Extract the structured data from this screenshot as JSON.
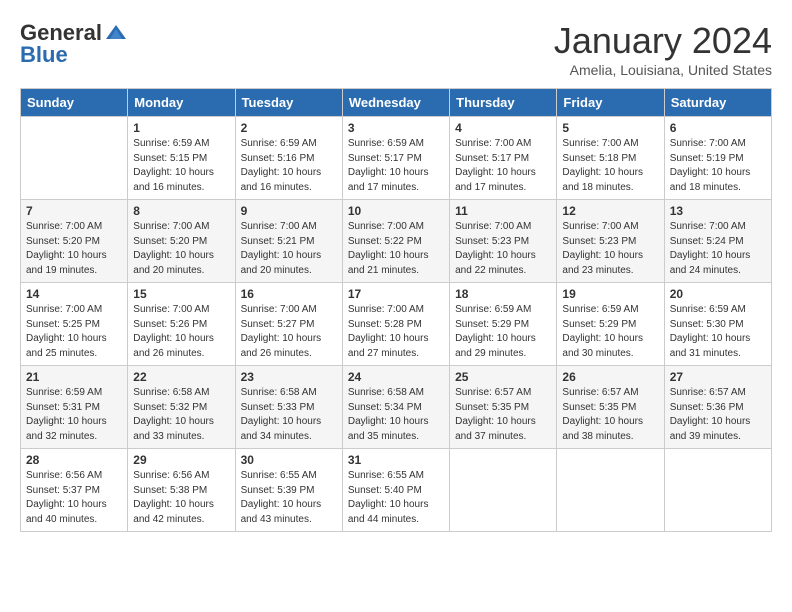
{
  "header": {
    "logo_general": "General",
    "logo_blue": "Blue",
    "month_title": "January 2024",
    "location": "Amelia, Louisiana, United States"
  },
  "days_of_week": [
    "Sunday",
    "Monday",
    "Tuesday",
    "Wednesday",
    "Thursday",
    "Friday",
    "Saturday"
  ],
  "weeks": [
    [
      {
        "day": "",
        "sunrise": "",
        "sunset": "",
        "daylight": ""
      },
      {
        "day": "1",
        "sunrise": "Sunrise: 6:59 AM",
        "sunset": "Sunset: 5:15 PM",
        "daylight": "Daylight: 10 hours and 16 minutes."
      },
      {
        "day": "2",
        "sunrise": "Sunrise: 6:59 AM",
        "sunset": "Sunset: 5:16 PM",
        "daylight": "Daylight: 10 hours and 16 minutes."
      },
      {
        "day": "3",
        "sunrise": "Sunrise: 6:59 AM",
        "sunset": "Sunset: 5:17 PM",
        "daylight": "Daylight: 10 hours and 17 minutes."
      },
      {
        "day": "4",
        "sunrise": "Sunrise: 7:00 AM",
        "sunset": "Sunset: 5:17 PM",
        "daylight": "Daylight: 10 hours and 17 minutes."
      },
      {
        "day": "5",
        "sunrise": "Sunrise: 7:00 AM",
        "sunset": "Sunset: 5:18 PM",
        "daylight": "Daylight: 10 hours and 18 minutes."
      },
      {
        "day": "6",
        "sunrise": "Sunrise: 7:00 AM",
        "sunset": "Sunset: 5:19 PM",
        "daylight": "Daylight: 10 hours and 18 minutes."
      }
    ],
    [
      {
        "day": "7",
        "sunrise": "Sunrise: 7:00 AM",
        "sunset": "Sunset: 5:20 PM",
        "daylight": "Daylight: 10 hours and 19 minutes."
      },
      {
        "day": "8",
        "sunrise": "Sunrise: 7:00 AM",
        "sunset": "Sunset: 5:20 PM",
        "daylight": "Daylight: 10 hours and 20 minutes."
      },
      {
        "day": "9",
        "sunrise": "Sunrise: 7:00 AM",
        "sunset": "Sunset: 5:21 PM",
        "daylight": "Daylight: 10 hours and 20 minutes."
      },
      {
        "day": "10",
        "sunrise": "Sunrise: 7:00 AM",
        "sunset": "Sunset: 5:22 PM",
        "daylight": "Daylight: 10 hours and 21 minutes."
      },
      {
        "day": "11",
        "sunrise": "Sunrise: 7:00 AM",
        "sunset": "Sunset: 5:23 PM",
        "daylight": "Daylight: 10 hours and 22 minutes."
      },
      {
        "day": "12",
        "sunrise": "Sunrise: 7:00 AM",
        "sunset": "Sunset: 5:23 PM",
        "daylight": "Daylight: 10 hours and 23 minutes."
      },
      {
        "day": "13",
        "sunrise": "Sunrise: 7:00 AM",
        "sunset": "Sunset: 5:24 PM",
        "daylight": "Daylight: 10 hours and 24 minutes."
      }
    ],
    [
      {
        "day": "14",
        "sunrise": "Sunrise: 7:00 AM",
        "sunset": "Sunset: 5:25 PM",
        "daylight": "Daylight: 10 hours and 25 minutes."
      },
      {
        "day": "15",
        "sunrise": "Sunrise: 7:00 AM",
        "sunset": "Sunset: 5:26 PM",
        "daylight": "Daylight: 10 hours and 26 minutes."
      },
      {
        "day": "16",
        "sunrise": "Sunrise: 7:00 AM",
        "sunset": "Sunset: 5:27 PM",
        "daylight": "Daylight: 10 hours and 26 minutes."
      },
      {
        "day": "17",
        "sunrise": "Sunrise: 7:00 AM",
        "sunset": "Sunset: 5:28 PM",
        "daylight": "Daylight: 10 hours and 27 minutes."
      },
      {
        "day": "18",
        "sunrise": "Sunrise: 6:59 AM",
        "sunset": "Sunset: 5:29 PM",
        "daylight": "Daylight: 10 hours and 29 minutes."
      },
      {
        "day": "19",
        "sunrise": "Sunrise: 6:59 AM",
        "sunset": "Sunset: 5:29 PM",
        "daylight": "Daylight: 10 hours and 30 minutes."
      },
      {
        "day": "20",
        "sunrise": "Sunrise: 6:59 AM",
        "sunset": "Sunset: 5:30 PM",
        "daylight": "Daylight: 10 hours and 31 minutes."
      }
    ],
    [
      {
        "day": "21",
        "sunrise": "Sunrise: 6:59 AM",
        "sunset": "Sunset: 5:31 PM",
        "daylight": "Daylight: 10 hours and 32 minutes."
      },
      {
        "day": "22",
        "sunrise": "Sunrise: 6:58 AM",
        "sunset": "Sunset: 5:32 PM",
        "daylight": "Daylight: 10 hours and 33 minutes."
      },
      {
        "day": "23",
        "sunrise": "Sunrise: 6:58 AM",
        "sunset": "Sunset: 5:33 PM",
        "daylight": "Daylight: 10 hours and 34 minutes."
      },
      {
        "day": "24",
        "sunrise": "Sunrise: 6:58 AM",
        "sunset": "Sunset: 5:34 PM",
        "daylight": "Daylight: 10 hours and 35 minutes."
      },
      {
        "day": "25",
        "sunrise": "Sunrise: 6:57 AM",
        "sunset": "Sunset: 5:35 PM",
        "daylight": "Daylight: 10 hours and 37 minutes."
      },
      {
        "day": "26",
        "sunrise": "Sunrise: 6:57 AM",
        "sunset": "Sunset: 5:35 PM",
        "daylight": "Daylight: 10 hours and 38 minutes."
      },
      {
        "day": "27",
        "sunrise": "Sunrise: 6:57 AM",
        "sunset": "Sunset: 5:36 PM",
        "daylight": "Daylight: 10 hours and 39 minutes."
      }
    ],
    [
      {
        "day": "28",
        "sunrise": "Sunrise: 6:56 AM",
        "sunset": "Sunset: 5:37 PM",
        "daylight": "Daylight: 10 hours and 40 minutes."
      },
      {
        "day": "29",
        "sunrise": "Sunrise: 6:56 AM",
        "sunset": "Sunset: 5:38 PM",
        "daylight": "Daylight: 10 hours and 42 minutes."
      },
      {
        "day": "30",
        "sunrise": "Sunrise: 6:55 AM",
        "sunset": "Sunset: 5:39 PM",
        "daylight": "Daylight: 10 hours and 43 minutes."
      },
      {
        "day": "31",
        "sunrise": "Sunrise: 6:55 AM",
        "sunset": "Sunset: 5:40 PM",
        "daylight": "Daylight: 10 hours and 44 minutes."
      },
      {
        "day": "",
        "sunrise": "",
        "sunset": "",
        "daylight": ""
      },
      {
        "day": "",
        "sunrise": "",
        "sunset": "",
        "daylight": ""
      },
      {
        "day": "",
        "sunrise": "",
        "sunset": "",
        "daylight": ""
      }
    ]
  ]
}
